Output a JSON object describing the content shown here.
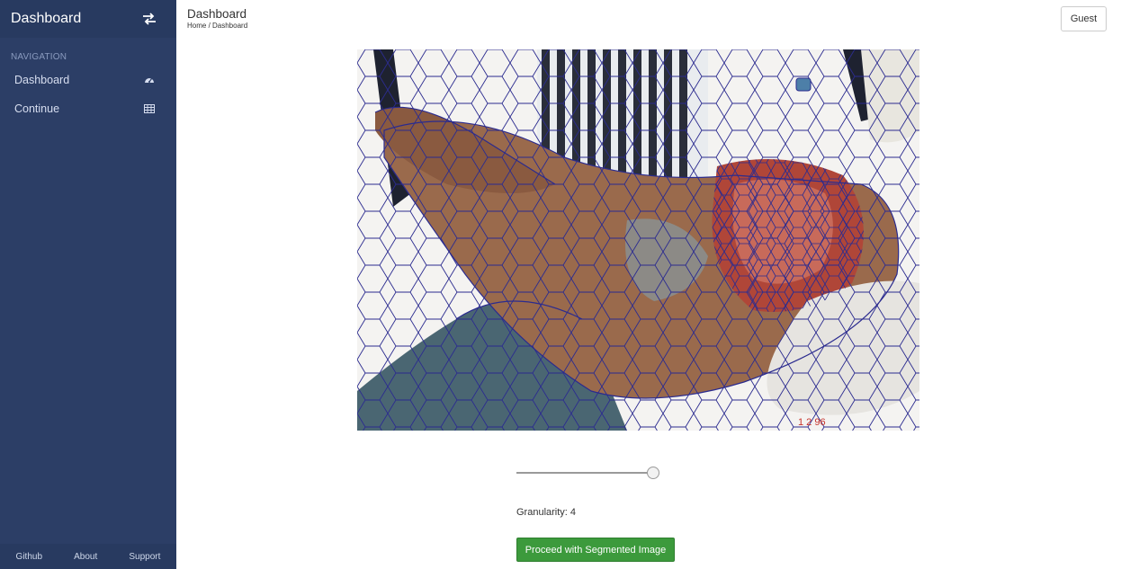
{
  "sidebar": {
    "brand": "Dashboard",
    "toggle_icon": "swap-arrows-icon",
    "section_label": "NAVIGATION",
    "items": [
      {
        "label": "Dashboard",
        "icon": "dashboard-gauge-icon"
      },
      {
        "label": "Continue",
        "icon": "table-grid-icon"
      }
    ],
    "footer": [
      "Github",
      "About",
      "Support"
    ]
  },
  "header": {
    "title": "Dashboard",
    "breadcrumb": "Home / Dashboard",
    "user_button": "Guest"
  },
  "main": {
    "image_description": "superpixel-segmented-image",
    "slider": {
      "value": 4,
      "min": 0,
      "max": 4
    },
    "granularity_text": "Granularity: 4",
    "proceed_button": "Proceed with Segmented Image"
  },
  "colors": {
    "sidebar_bg": "#2c3e66",
    "button_green": "#3c9a3c",
    "segment_lines": "#2b2b8f"
  }
}
